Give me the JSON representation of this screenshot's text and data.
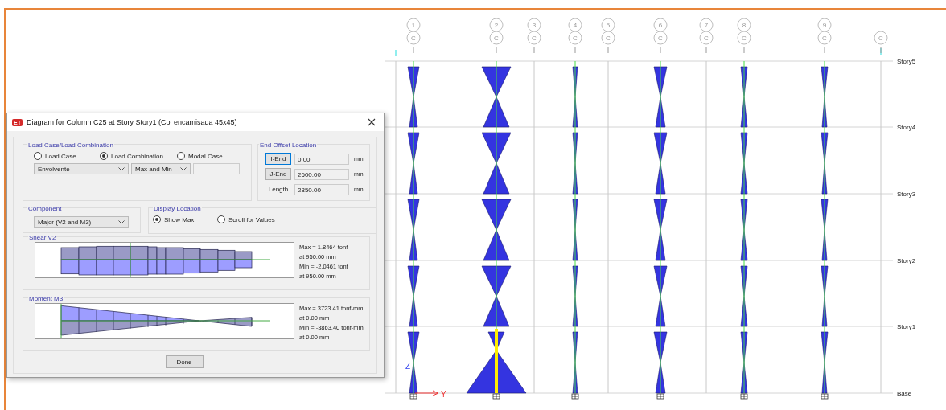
{
  "dialog": {
    "title": "Diagram for Column C25 at Story Story1 (Col encamisada 45x45)",
    "app_badge": "ET",
    "load_case": {
      "title": "Load Case/Load Combination",
      "radios": [
        {
          "label": "Load Case",
          "selected": false
        },
        {
          "label": "Load Combination",
          "selected": true
        },
        {
          "label": "Modal Case",
          "selected": false
        }
      ],
      "combination": "Envolvente",
      "mode": "Max and Min"
    },
    "end_offset": {
      "title": "End Offset Location",
      "rows": [
        {
          "kind": "button",
          "label": "I-End",
          "focused": true,
          "value": "0.00",
          "unit": "mm"
        },
        {
          "kind": "button",
          "label": "J-End",
          "focused": false,
          "value": "2600.00",
          "unit": "mm"
        },
        {
          "kind": "label",
          "label": "Length",
          "value": "2850.00",
          "unit": "mm"
        }
      ]
    },
    "component": {
      "title": "Component",
      "value": "Major (V2 and M3)"
    },
    "display_location": {
      "title": "Display Location",
      "radios": [
        {
          "label": "Show Max",
          "selected": true
        },
        {
          "label": "Scroll for Values",
          "selected": false
        }
      ]
    },
    "plots": [
      {
        "kind": "shear",
        "title": "Shear V2",
        "readouts": [
          "Max = 1.8464 tonf",
          "at 950.00 mm",
          "Min = -2.0461 tonf",
          "at 950.00 mm"
        ]
      },
      {
        "kind": "moment",
        "title": "Moment M3",
        "readouts": [
          "Max = 3723.41 tonf-mm",
          "at 0.00 mm",
          "Min = -3863.40 tonf-mm",
          "at 0.00 mm"
        ]
      }
    ],
    "done_button": "Done"
  },
  "elevation": {
    "grid_bubbles": [
      {
        "number": "1",
        "letter": "C"
      },
      {
        "number": "2",
        "letter": "C"
      },
      {
        "number": "3",
        "letter": "C"
      },
      {
        "number": "4",
        "letter": "C"
      },
      {
        "number": "5",
        "letter": "C"
      },
      {
        "number": "6",
        "letter": "C"
      },
      {
        "number": "7",
        "letter": "C"
      },
      {
        "number": "8",
        "letter": "C"
      },
      {
        "number": "9",
        "letter": "C"
      },
      {
        "letter": "C"
      }
    ],
    "stories": [
      "Story5",
      "Story4",
      "Story3",
      "Story2",
      "Story1",
      "Base"
    ],
    "axes": {
      "vertical": "Z",
      "horizontal": "Y"
    }
  }
}
